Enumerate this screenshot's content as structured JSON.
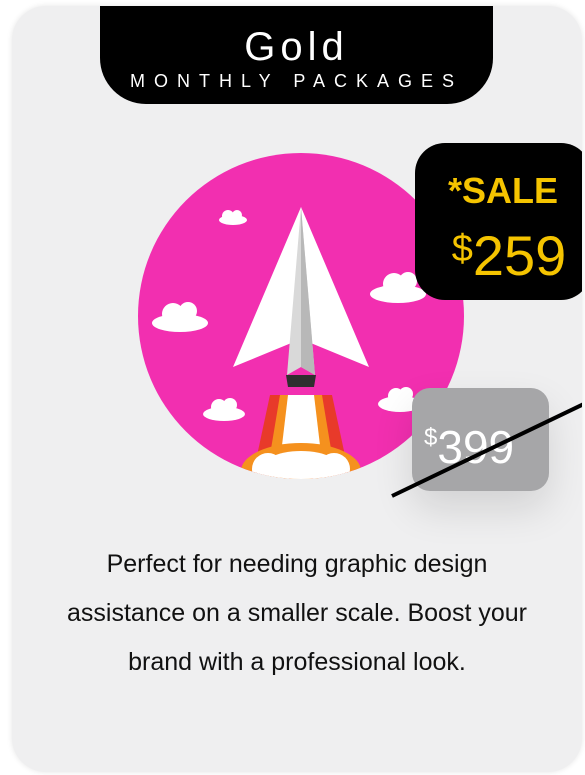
{
  "plan": {
    "name": "Gold",
    "subtitle": "MONTHLY PACKAGES"
  },
  "pricing": {
    "sale_label": "*SALE",
    "sale_currency": "$",
    "sale_amount": "259",
    "original_currency": "$",
    "original_amount": "399"
  },
  "description": "Perfect for needing graphic design assistance on a smaller scale. Boost your brand with a professional look.",
  "colors": {
    "accent_pink": "#f22fb0",
    "sale_yellow": "#f5c400",
    "header_black": "#000000",
    "old_price_gray": "#a6a6a8",
    "card_background": "#efeff0"
  },
  "illustration": {
    "icons": [
      "paper-plane-rocket-icon",
      "cloud-icon",
      "flame-icon"
    ]
  }
}
